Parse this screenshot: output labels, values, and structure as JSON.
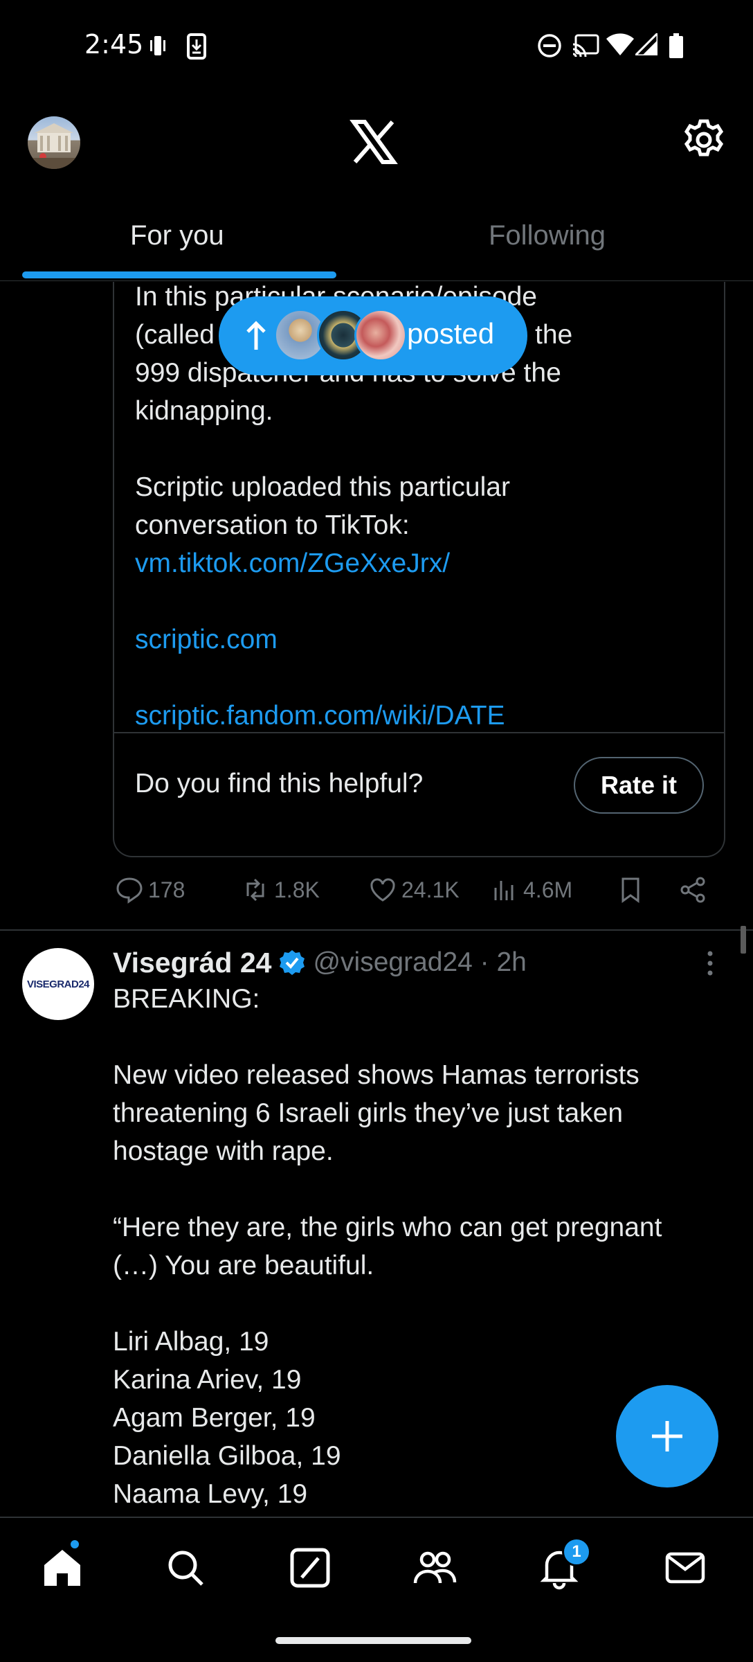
{
  "status_bar": {
    "time": "2:45",
    "left_icons": [
      "vibrate-icon",
      "download-icon"
    ],
    "right_icons": [
      "do-not-disturb-icon",
      "cast-icon",
      "wifi-icon",
      "signal-icon",
      "battery-icon"
    ]
  },
  "top_bar": {
    "avatar": "profile-avatar",
    "logo": "x-logo",
    "settings_icon": "gear-icon"
  },
  "tabs": [
    {
      "label": "For you",
      "active": true
    },
    {
      "label": "Following",
      "active": false
    }
  ],
  "new_posts_pill": {
    "label": "posted",
    "icon": "arrow-up-icon"
  },
  "community_note": {
    "lines": [
      "In this particular scenario/episode",
      "(called DATE) you are playing as the",
      "999 dispatcher and has to solve the",
      "kidnapping.",
      "",
      "Scriptic uploaded this particular",
      "conversation to TikTok:"
    ],
    "links": [
      "vm.tiktok.com/ZGeXxeJrx/",
      "scriptic.com",
      "scriptic.fandom.com/wiki/DATE"
    ],
    "helpful_prompt": "Do you find this helpful?",
    "rate_button": "Rate it"
  },
  "post_actions": {
    "replies": "178",
    "reposts": "1.8K",
    "likes": "24.1K",
    "views": "4.6M"
  },
  "post2": {
    "avatar_text": "VISEGRAD24",
    "name": "Visegrád 24",
    "handle_time": "@visegrad24 · 2h",
    "lines": [
      "BREAKING:",
      "",
      "New video released shows Hamas terrorists",
      "threatening 6 Israeli girls they’ve just taken",
      "hostage with rape.",
      "",
      "“Here they are, the girls who can get pregnant",
      "(…) You are beautiful.",
      "",
      "Liri Albag, 19",
      "Karina Ariev, 19",
      "Agam Berger, 19",
      "Daniella Gilboa, 19",
      "Naama Levy, 19"
    ]
  },
  "bottom_nav": {
    "items": [
      "home-icon",
      "search-icon",
      "grok-icon",
      "communities-icon",
      "notifications-icon",
      "messages-icon"
    ],
    "notifications_badge": "1"
  },
  "colors": {
    "accent": "#1d9bf0",
    "background": "#000000",
    "text": "#e7e9ea",
    "muted": "#71767b",
    "border": "#2f3336"
  }
}
